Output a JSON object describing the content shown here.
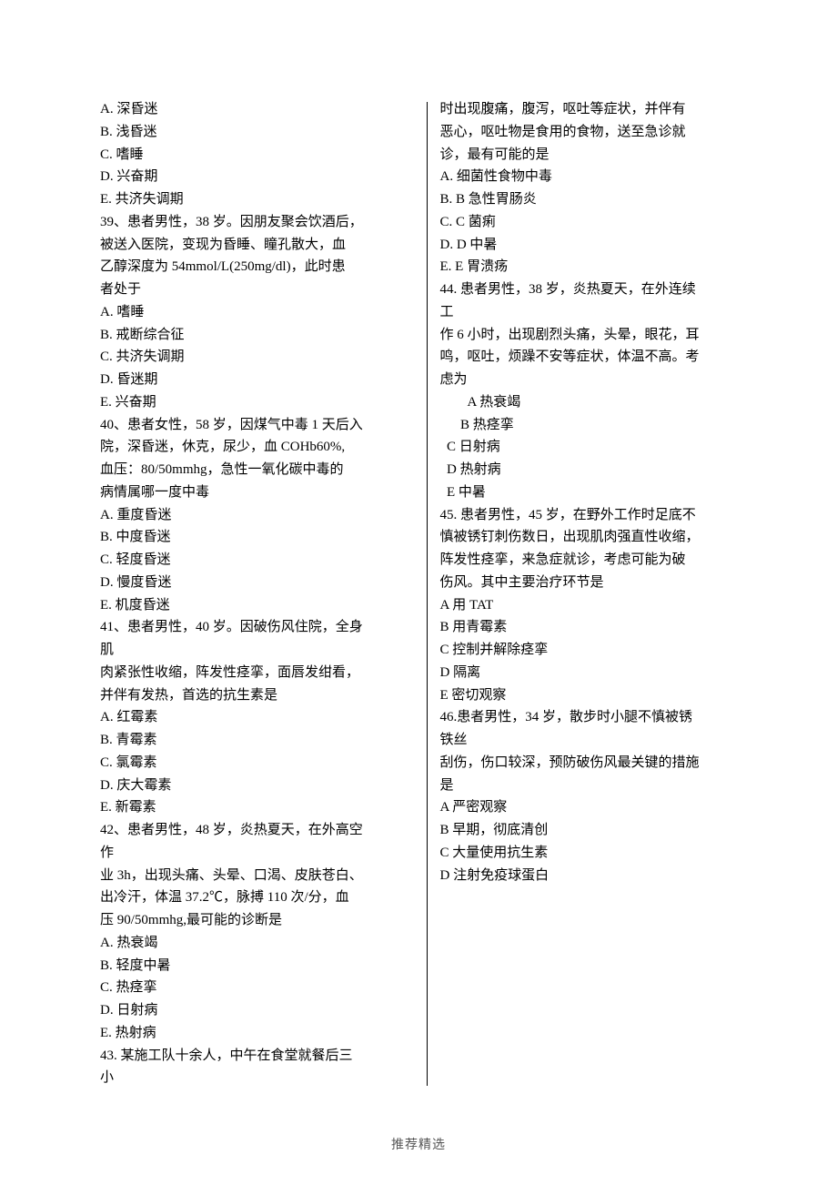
{
  "left": {
    "optA": "A.   深昏迷",
    "optB": "B.   浅昏迷",
    "optC": "C.   嗜睡",
    "optD": "D.   兴奋期",
    "optE": "E.   共济失调期",
    "q39_1": "39、患者男性，38 岁。因朋友聚会饮酒后，",
    "q39_2": "被送入医院，变现为昏睡、瞳孔散大，血",
    "q39_3": "乙醇深度为 54mmol/L(250mg/dl)，此时患",
    "q39_4": "者处于",
    "q39_a": "A. 嗜睡",
    "q39_b": "B. 戒断综合征",
    "q39_c": "C. 共济失调期",
    "q39_d": "D. 昏迷期",
    "q39_e": "E. 兴奋期",
    "q40_1": "40、患者女性，58 岁，因煤气中毒 1 天后入",
    "q40_2": "院，深昏迷，休克，尿少，血 COHb60%,",
    "q40_3": "血压：80/50mmhg，急性一氧化碳中毒的",
    "q40_4": "病情属哪一度中毒",
    "q40_a": "A. 重度昏迷",
    "q40_b": "B. 中度昏迷",
    "q40_c": "C. 轻度昏迷",
    "q40_d": "D. 慢度昏迷",
    "q40_e": "E. 机度昏迷",
    "q41_1": "41、患者男性，40 岁。因破伤风住院，全身",
    "q41_2": "肌",
    "q41_3": "肉紧张性收缩，阵发性痉挛，面唇发绀看，",
    "q41_4": "并伴有发热，首选的抗生素是",
    "q41_a": "A. 红霉素",
    "q41_b": "B. 青霉素",
    "q41_c": "C. 氯霉素",
    "q41_d": "D. 庆大霉素",
    "q41_e": "E. 新霉素",
    "q42_1": "42、患者男性，48 岁，炎热夏天，在外高空",
    "q42_2": "作",
    "q42_3": "业 3h，出现头痛、头晕、口渴、皮肤苍白、",
    "q42_4": "出冷汗，体温 37.2℃，脉搏 110 次/分，血",
    "q42_5": "压 90/50mmhg,最可能的诊断是",
    "q42_a": "A. 热衰竭",
    "q42_b": "B. 轻度中暑",
    "q42_c": "C. 热痉挛",
    "q42_d": "D. 日射病",
    "q42_e": "E. 热射病",
    "q43_1": "43. 某施工队十余人，中午在食堂就餐后三",
    "q43_2": "小"
  },
  "right": {
    "q43_3": "时出现腹痛，腹泻，呕吐等症状，并伴有",
    "q43_4": "恶心，呕吐物是食用的食物，送至急诊就",
    "q43_5": "诊，最有可能的是",
    "q43_a": "A.   细菌性食物中毒",
    "q43_b": "B.   B 急性胃肠炎",
    "q43_c": "C.   C 菌痢",
    "q43_d": "D.   D 中暑",
    "q43_e": "E.   E 胃溃疡",
    "q44_1": "44. 患者男性，38 岁，炎热夏天，在外连续",
    "q44_2": "工",
    "q44_3": "作 6 小时，出现剧烈头痛，头晕，眼花，耳",
    "q44_4": "鸣，呕吐，烦躁不安等症状，体温不高。考",
    "q44_5": "虑为",
    "q44_a": "A 热衰竭",
    "q44_b": "B 热痉挛",
    "q44_c": "C   日射病",
    "q44_d": "D 热射病",
    "q44_e": "E 中暑",
    "q45_1": "45. 患者男性，45 岁，在野外工作时足底不",
    "q45_2": "慎被锈钉刺伤数日，出现肌肉强直性收缩，",
    "q45_3": "阵发性痉挛，来急症就诊，考虑可能为破",
    "q45_4": "伤风。其中主要治疗环节是",
    "q45_a": "A 用 TAT",
    "q45_b": "B  用青霉素",
    "q45_c": "C 控制并解除痉挛",
    "q45_d": "D 隔离",
    "q45_e": "E 密切观察",
    "q46_1": "46.患者男性，34 岁，散步时小腿不慎被锈",
    "q46_2": "铁丝",
    "q46_3": "刮伤，伤口较深，预防破伤风最关键的措施",
    "q46_4": "是",
    "q46_a": "A 严密观察",
    "q46_b": "B 早期，彻底清创",
    "q46_c": "C 大量使用抗生素",
    "q46_d": "D 注射免疫球蛋白"
  },
  "footer": "推荐精选"
}
